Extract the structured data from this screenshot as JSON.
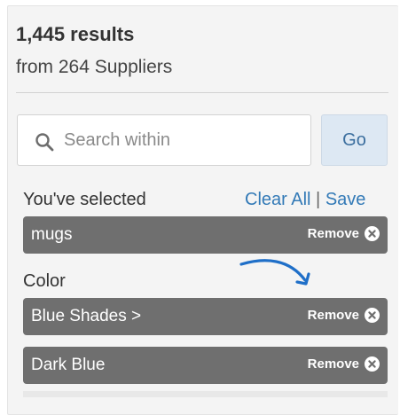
{
  "summary": {
    "results_count": "1,445 results",
    "suppliers": "from 264 Suppliers"
  },
  "search": {
    "placeholder": "Search within",
    "value": "",
    "go_label": "Go"
  },
  "selected": {
    "heading": "You've selected",
    "clear_all": "Clear All",
    "separator": "|",
    "save": "Save",
    "chips": [
      {
        "label": "mugs",
        "remove": "Remove"
      }
    ]
  },
  "color_filter": {
    "heading": "Color",
    "chips": [
      {
        "label": "Blue Shades >",
        "remove": "Remove"
      },
      {
        "label": "Dark Blue",
        "remove": "Remove"
      }
    ]
  },
  "colors": {
    "chip_bg": "#6f6f6f",
    "link": "#337ab7",
    "go_bg": "#dde8f3",
    "annotation_arrow": "#1f6fc8"
  },
  "icons": {
    "search": "search-icon",
    "remove": "close-circle-icon",
    "annotation": "curved-arrow-icon"
  }
}
